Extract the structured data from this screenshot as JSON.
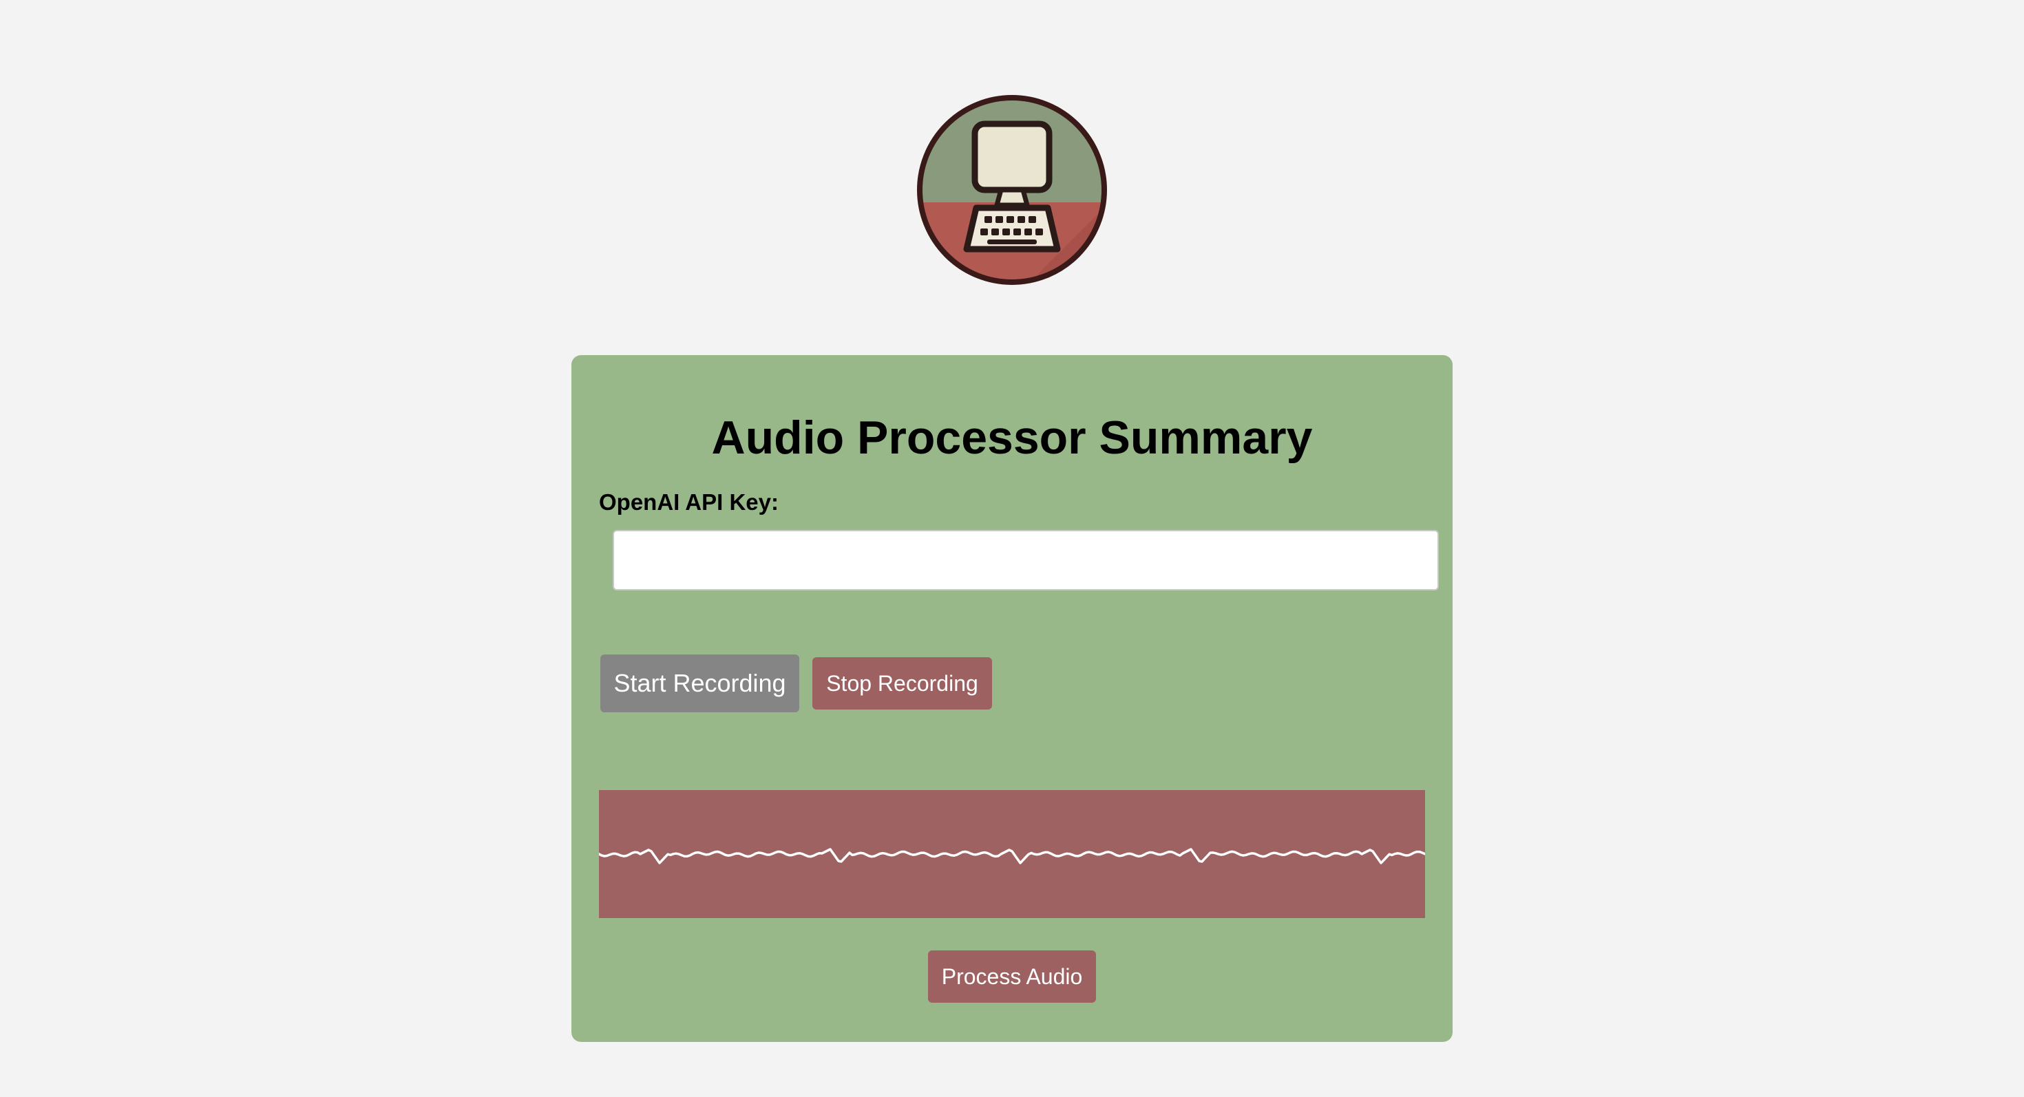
{
  "logo": {
    "icon": "computer-icon"
  },
  "card": {
    "title": "Audio Processor Summary",
    "api_key_label": "OpenAI API Key:",
    "api_key_value": "",
    "start_button": "Start Recording",
    "stop_button": "Stop Recording",
    "process_button": "Process Audio"
  },
  "colors": {
    "page_bg": "#f3f3f3",
    "card_bg": "#98b88a",
    "accent": "#9e6161",
    "start_button_bg": "#858585",
    "waveform_line": "#ffffff"
  }
}
